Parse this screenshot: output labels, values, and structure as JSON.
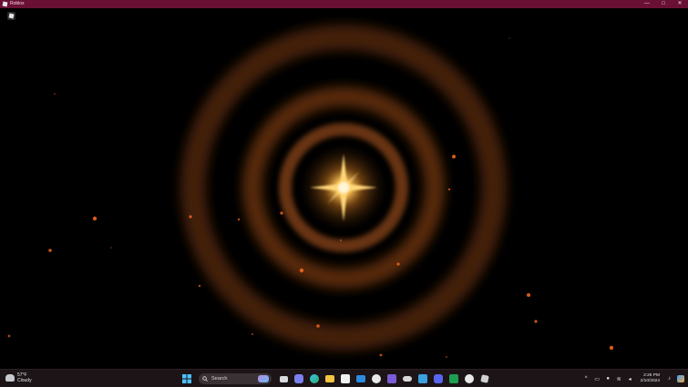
{
  "window": {
    "title": "Roblox",
    "minimize": "—",
    "maximize": "□",
    "close": "✕"
  },
  "game": {
    "menu_icon": "roblox-logo-icon",
    "scene": "glowing-star-concentric-rings"
  },
  "colors": {
    "titlebar": "#6a1035",
    "glow": "#ffb347",
    "ring": "#8a4a18",
    "particle": "#ff6a1e",
    "taskbar": "#1c1416"
  },
  "taskbar": {
    "weather": {
      "temp": "57°F",
      "condition": "Cloudy",
      "icon": "cloud-icon"
    },
    "search": {
      "placeholder": "Search"
    },
    "apps": [
      "windows-start-icon",
      "search-icon",
      "task-view-icon",
      "chat-icon",
      "edge-icon",
      "file-explorer-icon",
      "store-icon",
      "mail-icon",
      "xbox-icon",
      "visual-studio-icon",
      "controller-icon",
      "snipping-tool-icon",
      "discord-icon",
      "excel-icon",
      "media-player-icon",
      "roblox-icon"
    ],
    "tray": {
      "chevron": "^",
      "clock_time": "2:25 PM",
      "clock_date": "2/10/2024"
    }
  }
}
